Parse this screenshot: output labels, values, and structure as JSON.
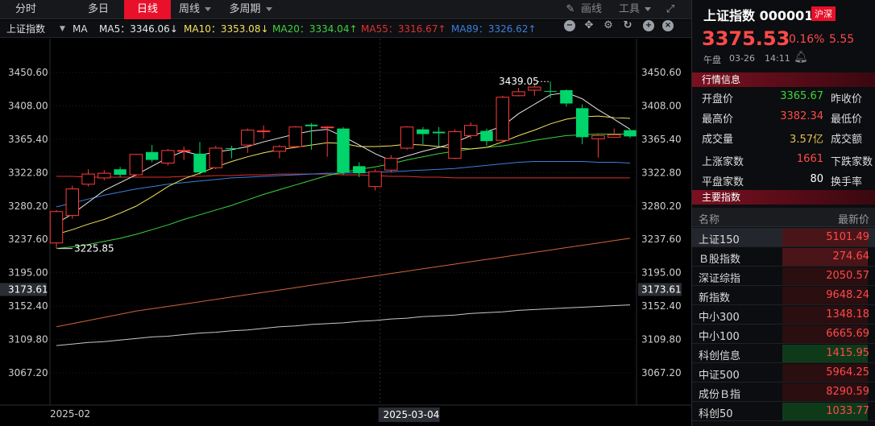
{
  "toolbar": {
    "tabs": [
      {
        "label": "分时",
        "active": false,
        "x": 4,
        "w": 56
      },
      {
        "label": "多日",
        "active": false,
        "x": 94,
        "w": 56
      },
      {
        "label": "日线",
        "active": true,
        "x": 154,
        "w": 58
      },
      {
        "label": "周线",
        "active": false,
        "x": 214,
        "w": 56
      },
      {
        "label": "多周期",
        "active": false,
        "x": 276,
        "w": 70
      }
    ],
    "draw_label": "画线",
    "tools_label": "工具"
  },
  "mabar": {
    "index_name": "上证指数",
    "ma_label": "MA",
    "ma5": "MA5：3346.06↓",
    "ma10": "MA10：3353.08↓",
    "ma20": "MA20：3334.04↑",
    "ma55": "MA55：3316.67↑",
    "ma89": "MA89：3326.62↑",
    "colors": {
      "ma5": "#e8e8e8",
      "ma10": "#f5e25a",
      "ma20": "#3cd43c",
      "ma55": "#e03030",
      "ma89": "#3a7fe0"
    }
  },
  "chart_data": {
    "type": "candlestick",
    "y_ticks": [
      "3450.60",
      "3408.00",
      "3365.40",
      "3322.80",
      "3280.20",
      "3237.60",
      "3195.00",
      "3152.40",
      "3109.80",
      "3067.20"
    ],
    "ylim": [
      3067.2,
      3450.6
    ],
    "current_price_label": "3173.61",
    "x_labels": [
      "2025-02",
      "2025-03-04"
    ],
    "high_annotation": "3439.05",
    "low_annotation": "3225.85",
    "colors": {
      "up": "#ff3b3b",
      "down": "#00d46a",
      "ma5": "#e8e8e8",
      "ma10": "#f5e25a",
      "ma20": "#3cd43c",
      "ma55": "#e03030",
      "ma89": "#3a7fe0",
      "long_orange": "#d0643a",
      "long_white": "#c8c8c8"
    },
    "candles": [
      {
        "o": 3233,
        "c": 3273,
        "h": 3275,
        "l": 3226
      },
      {
        "o": 3268,
        "c": 3302,
        "h": 3306,
        "l": 3264
      },
      {
        "o": 3308,
        "c": 3321,
        "h": 3327,
        "l": 3305
      },
      {
        "o": 3316,
        "c": 3322,
        "h": 3326,
        "l": 3313
      },
      {
        "o": 3327,
        "c": 3320,
        "h": 3330,
        "l": 3317
      },
      {
        "o": 3320,
        "c": 3346,
        "h": 3347,
        "l": 3318
      },
      {
        "o": 3349,
        "c": 3339,
        "h": 3358,
        "l": 3336
      },
      {
        "o": 3335,
        "c": 3351,
        "h": 3353,
        "l": 3332
      },
      {
        "o": 3351,
        "c": 3351,
        "h": 3356,
        "l": 3339
      },
      {
        "o": 3347,
        "c": 3323,
        "h": 3362,
        "l": 3320
      },
      {
        "o": 3329,
        "c": 3354,
        "h": 3357,
        "l": 3327
      },
      {
        "o": 3354,
        "c": 3353,
        "h": 3357,
        "l": 3341
      },
      {
        "o": 3358,
        "c": 3377,
        "h": 3379,
        "l": 3348
      },
      {
        "o": 3376,
        "c": 3376,
        "h": 3383,
        "l": 3366
      },
      {
        "o": 3350,
        "c": 3356,
        "h": 3358,
        "l": 3341
      },
      {
        "o": 3356,
        "c": 3381,
        "h": 3382,
        "l": 3355
      },
      {
        "o": 3384,
        "c": 3382,
        "h": 3386,
        "l": 3352
      },
      {
        "o": 3380,
        "c": 3381,
        "h": 3382,
        "l": 3343
      },
      {
        "o": 3379,
        "c": 3323,
        "h": 3381,
        "l": 3320
      },
      {
        "o": 3331,
        "c": 3322,
        "h": 3336,
        "l": 3317
      },
      {
        "o": 3305,
        "c": 3324,
        "h": 3327,
        "l": 3300
      },
      {
        "o": 3326,
        "c": 3341,
        "h": 3345,
        "l": 3323
      },
      {
        "o": 3354,
        "c": 3381,
        "h": 3382,
        "l": 3352
      },
      {
        "o": 3378,
        "c": 3372,
        "h": 3381,
        "l": 3359
      },
      {
        "o": 3375,
        "c": 3373,
        "h": 3381,
        "l": 3356
      },
      {
        "o": 3341,
        "c": 3375,
        "h": 3378,
        "l": 3340
      },
      {
        "o": 3370,
        "c": 3383,
        "h": 3387,
        "l": 3366
      },
      {
        "o": 3376,
        "c": 3363,
        "h": 3379,
        "l": 3357
      },
      {
        "o": 3364,
        "c": 3419,
        "h": 3421,
        "l": 3361
      },
      {
        "o": 3421,
        "c": 3426,
        "h": 3431,
        "l": 3420
      },
      {
        "o": 3428,
        "c": 3432,
        "h": 3436,
        "l": 3421
      },
      {
        "o": 3427,
        "c": 3426,
        "h": 3439,
        "l": 3418
      },
      {
        "o": 3428,
        "c": 3411,
        "h": 3429,
        "l": 3407
      },
      {
        "o": 3405,
        "c": 3368,
        "h": 3410,
        "l": 3359
      },
      {
        "o": 3366,
        "c": 3370,
        "h": 3371,
        "l": 3342
      },
      {
        "o": 3368,
        "c": 3371,
        "h": 3379,
        "l": 3368
      },
      {
        "o": 3377,
        "c": 3369,
        "h": 3378,
        "l": 3367
      }
    ],
    "ma5": [
      3258,
      3270,
      3285,
      3300,
      3310,
      3320,
      3331,
      3342,
      3350,
      3345,
      3349,
      3352,
      3356,
      3362,
      3367,
      3372,
      3376,
      3378,
      3369,
      3358,
      3347,
      3338,
      3344,
      3350,
      3355,
      3361,
      3370,
      3375,
      3382,
      3398,
      3410,
      3422,
      3425,
      3417,
      3403,
      3391,
      3378
    ],
    "ma10": [
      3244,
      3250,
      3257,
      3263,
      3271,
      3280,
      3292,
      3305,
      3315,
      3322,
      3330,
      3337,
      3343,
      3348,
      3352,
      3355,
      3358,
      3361,
      3360,
      3356,
      3356,
      3357,
      3359,
      3358,
      3356,
      3354,
      3353,
      3355,
      3362,
      3370,
      3377,
      3385,
      3391,
      3394,
      3395,
      3393,
      3392
    ],
    "ma20": [
      3226,
      3228,
      3231,
      3235,
      3239,
      3244,
      3250,
      3256,
      3263,
      3269,
      3275,
      3281,
      3288,
      3295,
      3301,
      3307,
      3313,
      3319,
      3323,
      3327,
      3330,
      3334,
      3339,
      3343,
      3347,
      3350,
      3353,
      3355,
      3357,
      3360,
      3364,
      3367,
      3370,
      3371,
      3372,
      3372,
      3372
    ],
    "ma55": [
      3318,
      3318,
      3317,
      3317,
      3317,
      3317,
      3317,
      3317,
      3318,
      3318,
      3319,
      3319,
      3320,
      3320,
      3321,
      3321,
      3321,
      3321,
      3320,
      3320,
      3319,
      3318,
      3318,
      3317,
      3317,
      3316,
      3316,
      3316,
      3316,
      3316,
      3316,
      3316,
      3316,
      3316,
      3316,
      3316,
      3316
    ],
    "ma89": [
      3279,
      3284,
      3289,
      3294,
      3298,
      3302,
      3305,
      3308,
      3310,
      3312,
      3314,
      3316,
      3317,
      3318,
      3319,
      3320,
      3321,
      3322,
      3322,
      3323,
      3323,
      3324,
      3325,
      3326,
      3327,
      3328,
      3330,
      3332,
      3334,
      3336,
      3337,
      3337,
      3337,
      3337,
      3336,
      3336,
      3335
    ],
    "long_orange": [
      3126,
      3130,
      3134,
      3138,
      3142,
      3146,
      3149,
      3152,
      3155,
      3158,
      3161,
      3164,
      3167,
      3170,
      3173,
      3176,
      3179,
      3182,
      3185,
      3188,
      3191,
      3194,
      3197,
      3200,
      3203,
      3206,
      3209,
      3212,
      3215,
      3218,
      3221,
      3224,
      3227,
      3230,
      3233,
      3236,
      3239
    ],
    "long_white": [
      3102,
      3104,
      3106,
      3107,
      3109,
      3111,
      3113,
      3114,
      3116,
      3118,
      3119,
      3121,
      3122,
      3124,
      3126,
      3127,
      3129,
      3130,
      3131,
      3133,
      3134,
      3136,
      3137,
      3139,
      3140,
      3141,
      3143,
      3144,
      3145,
      3147,
      3148,
      3149,
      3150,
      3151,
      3152,
      3153,
      3154
    ]
  },
  "panel": {
    "title": "上证指数 000001",
    "badge": "沪深",
    "price": "3375.53",
    "pct": "0.16%",
    "chg": "5.55",
    "session": "午盘",
    "date": "03-26",
    "time": "14:11",
    "quote_header": "行情信息",
    "quote": [
      {
        "label": "开盘价",
        "value": "3365.67",
        "color": "#3cd43c",
        "label2": "昨收价"
      },
      {
        "label": "最高价",
        "value": "3382.34",
        "color": "#ff4a4a",
        "label2": "最低价"
      },
      {
        "label": "成交量",
        "value": "3.57亿",
        "color": "#e0c050",
        "label2": "成交额"
      },
      {
        "label": "上涨家数",
        "value": "1661",
        "color": "#ff4a4a",
        "label2": "下跌家数"
      },
      {
        "label": "平盘家数",
        "value": "80",
        "color": "#ffffff",
        "label2": "换手率"
      }
    ],
    "index_header": "主要指数",
    "col_name": "名称",
    "col_price": "最新价",
    "indices": [
      {
        "name": "上证150",
        "value": "5101.49",
        "bg": "#4a1518",
        "sel": true
      },
      {
        "name": "Ｂ股指数",
        "value": "274.64",
        "bg": "#4a1518",
        "sel": false
      },
      {
        "name": "深证综指",
        "value": "2050.57",
        "bg": "#2a0e10",
        "sel": false
      },
      {
        "name": "新指数",
        "value": "9648.24",
        "bg": "#2a0e10",
        "sel": false
      },
      {
        "name": "中小300",
        "value": "1348.18",
        "bg": "#2a0e10",
        "sel": false
      },
      {
        "name": "中小100",
        "value": "6665.69",
        "bg": "#2a0e10",
        "sel": false
      },
      {
        "name": "科创信息",
        "value": "1415.95",
        "bg": "#0f3a1a",
        "sel": false
      },
      {
        "name": "中证500",
        "value": "5964.25",
        "bg": "#2a0e10",
        "sel": false
      },
      {
        "name": "成份Ｂ指",
        "value": "8290.59",
        "bg": "#2a0e10",
        "sel": false
      },
      {
        "name": "科创50",
        "value": "1033.77",
        "bg": "#0f3a1a",
        "sel": false
      }
    ]
  }
}
